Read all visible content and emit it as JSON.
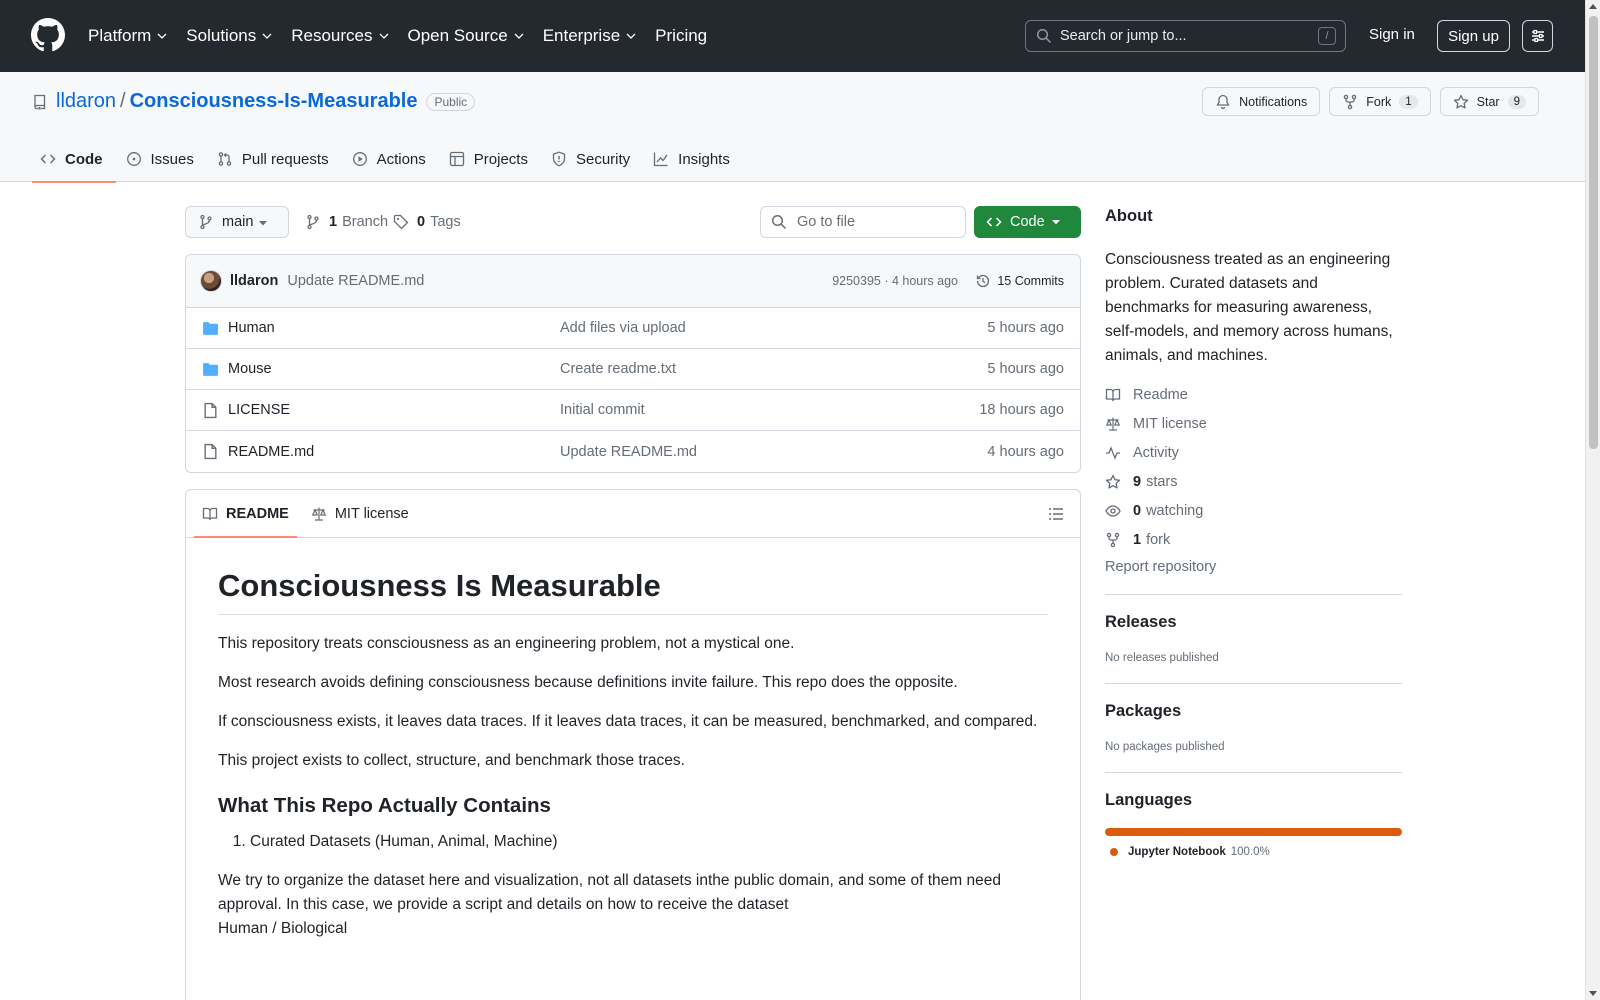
{
  "header": {
    "nav": [
      {
        "label": "Platform",
        "has_menu": true
      },
      {
        "label": "Solutions",
        "has_menu": true
      },
      {
        "label": "Resources",
        "has_menu": true
      },
      {
        "label": "Open Source",
        "has_menu": true
      },
      {
        "label": "Enterprise",
        "has_menu": true
      },
      {
        "label": "Pricing",
        "has_menu": false
      }
    ],
    "search_placeholder": "Search or jump to...",
    "search_shortcut": "/",
    "signin": "Sign in",
    "signup": "Sign up"
  },
  "repo": {
    "owner": "lldaron",
    "separator": "/",
    "name": "Consciousness-Is-Measurable",
    "visibility": "Public",
    "notifications_label": "Notifications",
    "fork_label": "Fork",
    "fork_count": "1",
    "star_label": "Star",
    "star_count": "9",
    "tabs": [
      {
        "label": "Code",
        "icon": "code-icon",
        "active": true
      },
      {
        "label": "Issues",
        "icon": "issue-icon",
        "active": false
      },
      {
        "label": "Pull requests",
        "icon": "pull-request-icon",
        "active": false
      },
      {
        "label": "Actions",
        "icon": "play-icon",
        "active": false
      },
      {
        "label": "Projects",
        "icon": "table-icon",
        "active": false
      },
      {
        "label": "Security",
        "icon": "shield-icon",
        "active": false
      },
      {
        "label": "Insights",
        "icon": "graph-icon",
        "active": false
      }
    ]
  },
  "toolbar": {
    "branch": "main",
    "branches_count": "1",
    "branches_label": "Branch",
    "tags_count": "0",
    "tags_label": "Tags",
    "goto_placeholder": "Go to file",
    "code_label": "Code"
  },
  "latest_commit": {
    "author": "lldaron",
    "message": "Update README.md",
    "sha_time": "9250395 · 4 hours ago",
    "commits_label": "15 Commits"
  },
  "files": [
    {
      "name": "Human",
      "type": "dir",
      "message": "Add files via upload",
      "time": "5 hours ago"
    },
    {
      "name": "Mouse",
      "type": "dir",
      "message": "Create readme.txt",
      "time": "5 hours ago"
    },
    {
      "name": "LICENSE",
      "type": "file",
      "message": "Initial commit",
      "time": "18 hours ago"
    },
    {
      "name": "README.md",
      "type": "file",
      "message": "Update README.md",
      "time": "4 hours ago"
    }
  ],
  "readme": {
    "tab_readme": "README",
    "tab_license": "MIT license",
    "h1": "Consciousness Is Measurable",
    "p1": "This repository treats consciousness as an engineering problem, not a mystical one.",
    "p2": "Most research avoids defining consciousness because definitions invite failure. This repo does the opposite.",
    "p3": "If consciousness exists, it leaves data traces. If it leaves data traces, it can be measured, benchmarked, and compared.",
    "p4": "This project exists to collect, structure, and benchmark those traces.",
    "h2": "What This Repo Actually Contains",
    "list": [
      "Curated Datasets (Human, Animal, Machine)"
    ],
    "p5_line1": "We try to organize the dataset here and visualization, not all datasets inthe public domain, and some of them need approval. In this case, we provide a script and details on how to receive the dataset",
    "p5_line2": "Human / Biological"
  },
  "sidebar": {
    "about_title": "About",
    "about_text": "Consciousness treated as an engineering problem. Curated datasets and benchmarks for measuring awareness, self-models, and memory across humans, animals, and machines.",
    "links": [
      {
        "icon": "book-icon",
        "count": "",
        "label": "Readme"
      },
      {
        "icon": "law-icon",
        "count": "",
        "label": "MIT license"
      },
      {
        "icon": "pulse-icon",
        "count": "",
        "label": "Activity"
      },
      {
        "icon": "star-icon",
        "count": "9",
        "label": "stars"
      },
      {
        "icon": "eye-icon",
        "count": "0",
        "label": "watching"
      },
      {
        "icon": "fork-icon",
        "count": "1",
        "label": "fork"
      }
    ],
    "report": "Report repository",
    "releases_title": "Releases",
    "releases_text": "No releases published",
    "packages_title": "Packages",
    "packages_text": "No packages published",
    "languages_title": "Languages",
    "languages": [
      {
        "name": "Jupyter Notebook",
        "percent": "100.0%",
        "color": "#da5b0b"
      }
    ]
  },
  "colors": {
    "header_bg": "#24292f",
    "link_blue": "#0969da",
    "code_button_green": "#1f883d",
    "active_tab_underline": "#fd8c73",
    "folder_blue": "#54aeff"
  }
}
